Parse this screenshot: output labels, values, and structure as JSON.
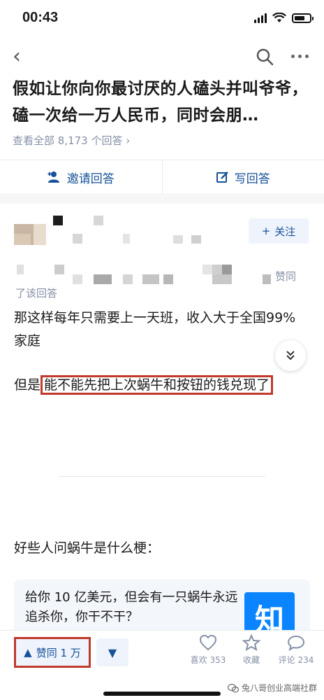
{
  "status": {
    "time": "00:43"
  },
  "question": {
    "title": "假如让你向你最讨厌的人磕头并叫爷爷，磕一次给一万人民币，同时会朋…",
    "meta": "查看全部 8,173 个回答 ›"
  },
  "actions": {
    "invite": "邀请回答",
    "write": "写回答"
  },
  "author": {
    "follow": "关注",
    "agree_pre": "赞同",
    "agree_post": "了该回答"
  },
  "answer": {
    "p1": "那这样每年只需要上一天班，收入大于全国99%家庭",
    "p2_pre": "但是",
    "p2_highlight": "能不能先把上次蜗牛和按钮的钱兑现了",
    "p3": "好些人问蜗牛是什么梗："
  },
  "card": {
    "text": "给你 10 亿美元，但会有一只蜗牛永远追杀你，你干不干？",
    "logo": "知"
  },
  "bottom": {
    "upvote": "赞同 1 万",
    "like": "喜欢 353",
    "collect": "收藏",
    "comment": "评论 234",
    "watermark": "兔八哥创业高端社群"
  },
  "colors": {
    "accent": "#175199",
    "highlight": "#c0392b",
    "logo_bg": "#0a84ff"
  },
  "icons": [
    "signal-icon",
    "wifi-icon",
    "battery-icon",
    "back-arrow-icon",
    "search-icon",
    "more-icon",
    "invite-icon",
    "write-icon",
    "plus-icon",
    "fold-icon",
    "upvote-icon",
    "downvote-icon",
    "heart-icon",
    "star-icon",
    "comment-icon",
    "wechat-icon"
  ]
}
